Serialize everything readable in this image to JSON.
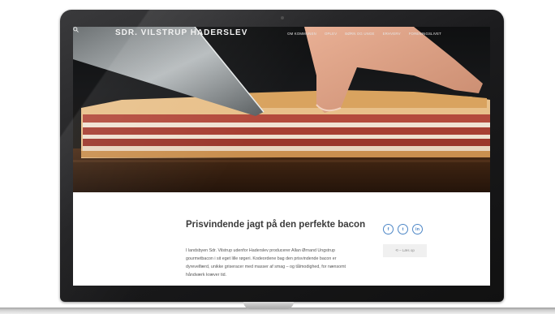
{
  "site": {
    "logo_text": "SDR. VILSTRUP HADERSLEV"
  },
  "nav": {
    "items": [
      "OM KOMMUNEN",
      "OPLEV",
      "BØRN OG UNGE",
      "ERHVERV",
      "FORENINGSLIVET"
    ]
  },
  "article": {
    "title": "Prisvindende jagt på den perfekte bacon",
    "body": "I landsbyen Sdr. Vilstrup udenfor Haderslev producerer Allan Ørnand Ungstrup gourmetbacon i sit eget lille røgeri. Kodeordene bag den prisvindende bacon er dyrevelfærd, unikke griseracer med masser af smag – og tålmodighed, for nænsomt håndværk kræver tid."
  },
  "share": {
    "facebook": "f",
    "twitter": "t",
    "linkedin": "in"
  },
  "sidebar": {
    "read_label": "⟲ – Læs op"
  },
  "icons": {
    "search": "search-icon",
    "facebook": "facebook-icon",
    "twitter": "twitter-icon",
    "linkedin": "linkedin-icon"
  },
  "colors": {
    "accent": "#4c86c6",
    "title": "#3b3b3b"
  }
}
